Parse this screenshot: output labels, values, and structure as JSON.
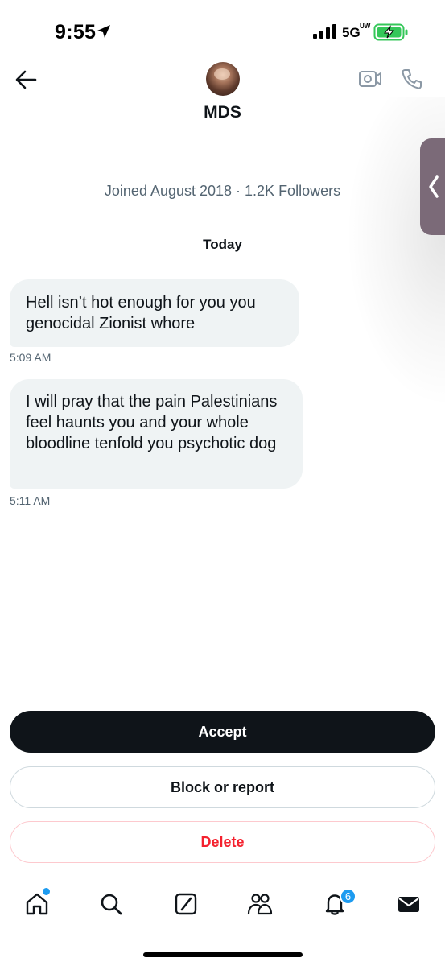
{
  "status_bar": {
    "time": "9:55",
    "network": "5G",
    "network_sup": "UW",
    "icons": [
      "location-arrow-icon",
      "signal-bars-icon",
      "battery-charging-icon"
    ]
  },
  "header": {
    "contact_name": "MDS",
    "icons": [
      "back-arrow-icon",
      "video-call-icon",
      "phone-call-icon"
    ]
  },
  "profile_meta": "Joined August 2018 · 1.2K Followers",
  "conversation": {
    "date_label": "Today",
    "messages": [
      {
        "text": "Hell isn’t hot enough for you you genocidal Zionist whore",
        "time": "5:09 AM"
      },
      {
        "text": "I will pray that the pain Palestinians feel haunts you and your whole bloodline tenfold you psychotic dog",
        "time": "5:11 AM"
      }
    ]
  },
  "actions": {
    "accept": "Accept",
    "block_or_report": "Block or report",
    "delete": "Delete"
  },
  "nav": {
    "items": [
      "home-icon",
      "search-icon",
      "compose-icon",
      "communities-icon",
      "notifications-icon",
      "messages-icon"
    ],
    "notification_count": "6"
  },
  "colors": {
    "primary_text": "#0f1419",
    "secondary_text": "#536471",
    "bubble": "#eff3f4",
    "accent_blue": "#1d9bf0",
    "danger_red": "#f4212e",
    "battery_green": "#34c759"
  }
}
